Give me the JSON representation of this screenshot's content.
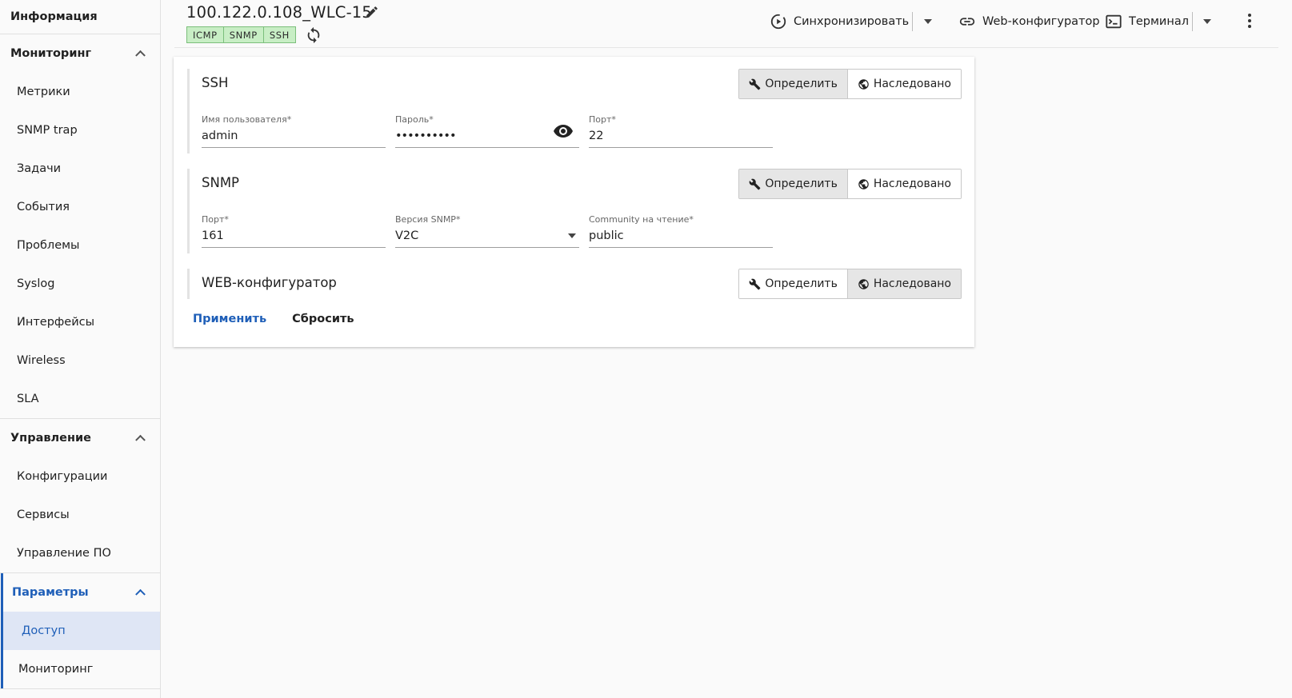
{
  "sidebar": {
    "info": "Информация",
    "monitoring": {
      "title": "Мониторинг",
      "items": [
        "Метрики",
        "SNMP trap",
        "Задачи",
        "События",
        "Проблемы",
        "Syslog",
        "Интерфейсы",
        "Wireless",
        "SLA"
      ]
    },
    "management": {
      "title": "Управление",
      "items": [
        "Конфигурации",
        "Сервисы",
        "Управление ПО"
      ]
    },
    "parameters": {
      "title": "Параметры",
      "items": [
        "Доступ",
        "Мониторинг"
      ],
      "active_item": "Доступ"
    }
  },
  "header": {
    "title": "100.122.0.108_WLC-15",
    "badges": [
      "ICMP",
      "SNMP",
      "SSH"
    ],
    "sync_label": "Синхронизировать",
    "web_label": "Web-конфигуратор",
    "terminal_label": "Терминал"
  },
  "ssh": {
    "title": "SSH",
    "define": "Определить",
    "inherited": "Наследовано",
    "selected": "define",
    "username_label": "Имя пользователя*",
    "username": "admin",
    "password_label": "Пароль*",
    "password": "••••••••••",
    "port_label": "Порт*",
    "port": "22"
  },
  "snmp": {
    "title": "SNMP",
    "define": "Определить",
    "inherited": "Наследовано",
    "selected": "define",
    "port_label": "Порт*",
    "port": "161",
    "version_label": "Версия SNMP*",
    "version": "V2C",
    "community_label": "Community на чтение*",
    "community": "public"
  },
  "web": {
    "title": "WEB-конфигуратор",
    "define": "Определить",
    "inherited": "Наследовано",
    "selected": "inherited"
  },
  "actions": {
    "apply": "Применить",
    "reset": "Сбросить"
  },
  "colors": {
    "accent": "#1f5fb8",
    "badge_bg": "#c8eec5",
    "active_item_bg": "#dfe6f5"
  }
}
